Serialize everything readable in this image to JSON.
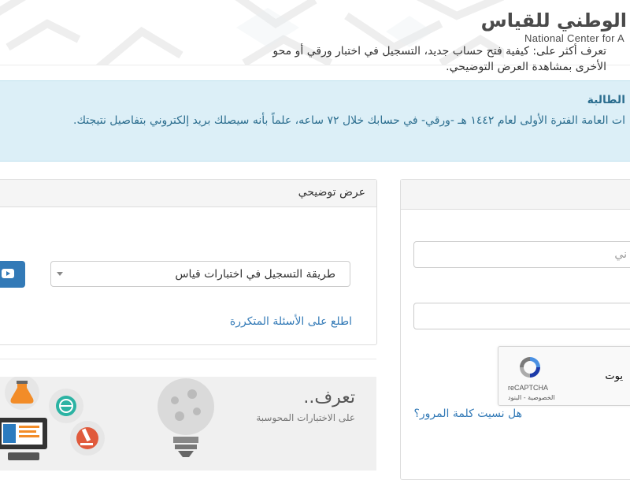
{
  "header": {
    "logo_ar": "الوطني للقياس",
    "logo_en": "National Center for A"
  },
  "alert": {
    "title": "الطالبة",
    "message": "ات العامة الفترة الأولى لعام ١٤٤٢ هـ -ورقي- في حسابك خلال ٧٢ ساعه، علماً بأنه سيصلك بريد إلكتروني بتفاصيل نتيجتك."
  },
  "demo": {
    "title": "عرض توضيحي",
    "desc_line1": "تعرف أكثر على: كيفية فتح حساب جديد، التسجيل في اختبار ورقي أو محو",
    "desc_line2": "الأخرى بمشاهدة العرض التوضيحي.",
    "select_value": "طريقة التسجيل في اختبارات قياس",
    "faq_link": "اطلع على الأسئلة المتكررة",
    "video_icon": "youtube-play-icon"
  },
  "banner": {
    "title": "تعرف..",
    "subtitle": "على الاختبارات المحوسبة"
  },
  "login": {
    "username_placeholder": "ني",
    "recaptcha_label": "يوت",
    "recaptcha_brand": "reCAPTCHA",
    "recaptcha_links": "الخصوصية - البنود",
    "forgot_password": "هل نسيت كلمة المرور؟"
  },
  "colors": {
    "alert_bg": "#dceff7",
    "alert_text": "#2c6e8f",
    "link": "#337ab7",
    "primary_button": "#337ab7"
  }
}
